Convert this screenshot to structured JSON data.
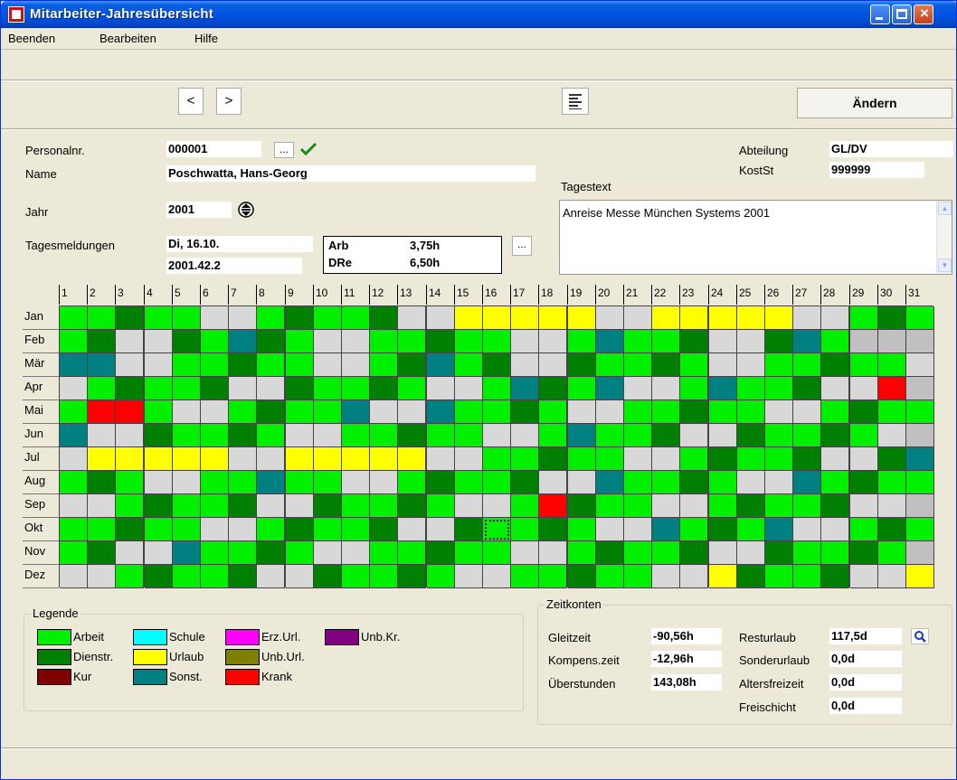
{
  "window": {
    "title": "Mitarbeiter-Jahresübersicht"
  },
  "menu": {
    "items": [
      "Beenden",
      "Bearbeiten",
      "Hilfe"
    ]
  },
  "toolbar": {
    "prev_label": "<",
    "next_label": ">",
    "change_label": "Ändern"
  },
  "employee": {
    "personalnr_label": "Personalnr.",
    "personalnr": "000001",
    "browse_label": "...",
    "name_label": "Name",
    "name": "Poschwatta, Hans-Georg",
    "jahr_label": "Jahr",
    "jahr": "2001",
    "tagesmeldungen_label": "Tagesmeldungen",
    "day": "Di, 16.10.",
    "week": "2001.42.2",
    "abteilung_label": "Abteilung",
    "abteilung": "GL/DV",
    "kostst_label": "KostSt",
    "kostst": "999999",
    "tagestext_label": "Tagestext",
    "tagestext": "Anreise Messe München Systems 2001"
  },
  "day_info": {
    "rows": [
      {
        "label": "Arb",
        "value": "3,75h"
      },
      {
        "label": "DRe",
        "value": "6,50h"
      }
    ],
    "more_label": "..."
  },
  "calendar": {
    "days": [
      "1",
      "2",
      "3",
      "4",
      "5",
      "6",
      "7",
      "8",
      "9",
      "10",
      "11",
      "12",
      "13",
      "14",
      "15",
      "16",
      "17",
      "18",
      "19",
      "20",
      "21",
      "22",
      "23",
      "24",
      "25",
      "26",
      "27",
      "28",
      "29",
      "30",
      "31"
    ],
    "months": [
      "Jan",
      "Feb",
      "Mär",
      "Apr",
      "Mai",
      "Jun",
      "Jul",
      "Aug",
      "Sep",
      "Okt",
      "Nov",
      "Dez"
    ],
    "selected": {
      "month": "Okt",
      "day": 16
    }
  },
  "legend": {
    "title": "Legende",
    "items": [
      {
        "label": "Arbeit",
        "color": "#00f000"
      },
      {
        "label": "Dienstr.",
        "color": "#008000"
      },
      {
        "label": "Kur",
        "color": "#800000"
      },
      {
        "label": "Schule",
        "color": "#00ffff"
      },
      {
        "label": "Urlaub",
        "color": "#ffff00"
      },
      {
        "label": "Sonst.",
        "color": "#008080"
      },
      {
        "label": "Erz.Url.",
        "color": "#ff00ff"
      },
      {
        "label": "Unb.Url.",
        "color": "#808000"
      },
      {
        "label": "Krank",
        "color": "#ff0000"
      },
      {
        "label": "Unb.Kr.",
        "color": "#800080"
      }
    ]
  },
  "zeitkonten": {
    "title": "Zeitkonten",
    "gleitzeit_label": "Gleitzeit",
    "gleitzeit": "-90,56h",
    "kompens_label": "Kompens.zeit",
    "kompens": "-12,96h",
    "ueberstunden_label": "Überstunden",
    "ueberstunden": "143,08h",
    "resturlaub_label": "Resturlaub",
    "resturlaub": "117,5d",
    "sonderurlaub_label": "Sonderurlaub",
    "sonderurlaub": "0,0d",
    "altersfreizeit_label": "Altersfreizeit",
    "altersfreizeit": "0,0d",
    "freischicht_label": "Freischicht",
    "freischicht": "0,0d"
  },
  "colors": {
    "arbeit": "#00f000",
    "dienstr": "#008000",
    "urlaub": "#ffff00",
    "krank": "#ff0000",
    "sonst": "#008080",
    "frei": "#d8d8d8",
    "ungueltig": "#c0c0c0"
  }
}
